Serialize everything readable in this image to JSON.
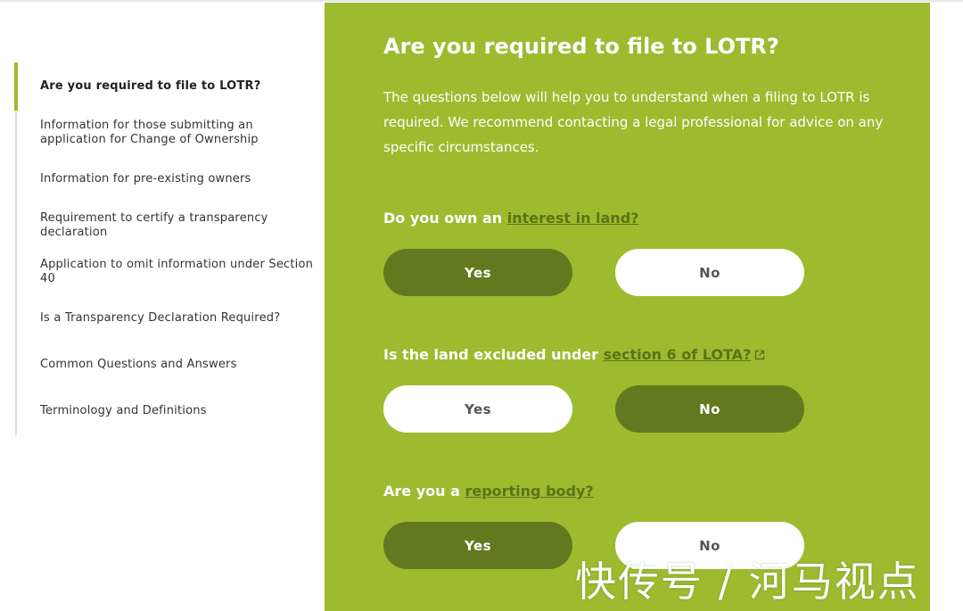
{
  "sidebar": {
    "items": [
      {
        "label": "Are you required to file to LOTR?",
        "active": true
      },
      {
        "label": "Information for those submitting an application for Change of Ownership",
        "active": false
      },
      {
        "label": "Information for pre-existing owners",
        "active": false
      },
      {
        "label": "Requirement to certify a transparency declaration",
        "active": false
      },
      {
        "label": "Application to omit information under Section 40",
        "active": false
      },
      {
        "label": "Is a Transparency Declaration Required?",
        "active": false
      },
      {
        "label": "Common Questions and Answers",
        "active": false
      },
      {
        "label": "Terminology and Definitions",
        "active": false
      }
    ]
  },
  "main": {
    "title": "Are you required to file to LOTR?",
    "intro": "The questions below will help you to understand when a filing to LOTR is required. We recommend contacting a legal professional for advice on any specific circumstances.",
    "questions": [
      {
        "prefix": "Do you own an ",
        "link": "interest in land?",
        "external": false,
        "yes_label": "Yes",
        "no_label": "No",
        "selected": "yes"
      },
      {
        "prefix": "Is the land excluded under ",
        "link": "section 6 of LOTA?",
        "external": true,
        "yes_label": "Yes",
        "no_label": "No",
        "selected": "no"
      },
      {
        "prefix": "Are you a ",
        "link": "reporting body?",
        "external": false,
        "yes_label": "Yes",
        "no_label": "No",
        "selected": "yes"
      }
    ]
  },
  "watermark": "快传号 / 河马视点",
  "colors": {
    "panel_green": "#9cbb2f",
    "selected_button": "#627a1f",
    "link_green": "#5a7417",
    "unselected_button": "#ffffff",
    "sidebar_active_bar": "#9cbb2f"
  }
}
